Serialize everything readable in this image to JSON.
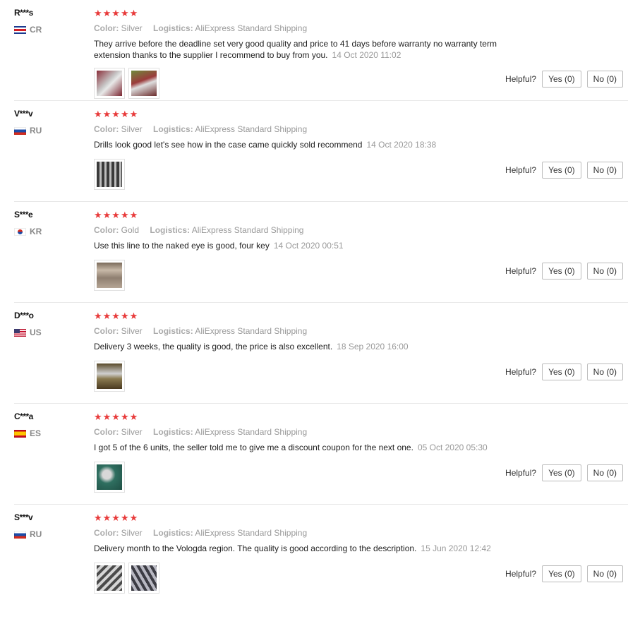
{
  "labels": {
    "color": "Color:",
    "logistics": "Logistics:",
    "helpful": "Helpful?",
    "stars": "★★★★★"
  },
  "colors": {
    "star": "#e83a3a"
  },
  "reviews": [
    {
      "user": "R***s",
      "country": "CR",
      "rating": 5,
      "color": "Silver",
      "logistics": "AliExpress Standard Shipping",
      "text": "They arrive before the deadline set very good quality and price to 41 days before warranty no warranty term extension thanks to the supplier I recommend to buy from you.",
      "date": "14 Oct 2020 11:02",
      "yes": "Yes (0)",
      "no": "No (0)"
    },
    {
      "user": "V***v",
      "country": "RU",
      "rating": 5,
      "color": "Silver",
      "logistics": "AliExpress Standard Shipping",
      "text": "Drills look good let's see how in the case came quickly sold recommend",
      "date": "14 Oct 2020 18:38",
      "yes": "Yes (0)",
      "no": "No (0)"
    },
    {
      "user": "S***e",
      "country": "KR",
      "rating": 5,
      "color": "Gold",
      "logistics": "AliExpress Standard Shipping",
      "text": "Use this line to the naked eye is good, four key",
      "date": "14 Oct 2020 00:51",
      "yes": "Yes (0)",
      "no": "No (0)"
    },
    {
      "user": "D***o",
      "country": "US",
      "rating": 5,
      "color": "Silver",
      "logistics": "AliExpress Standard Shipping",
      "text": "Delivery 3 weeks, the quality is good, the price is also excellent.",
      "date": "18 Sep 2020 16:00",
      "yes": "Yes (0)",
      "no": "No (0)"
    },
    {
      "user": "C***a",
      "country": "ES",
      "rating": 5,
      "color": "Silver",
      "logistics": "AliExpress Standard Shipping",
      "text": "I got 5 of the 6 units, the seller told me to give me a discount coupon for the next one.",
      "date": "05 Oct 2020 05:30",
      "yes": "Yes (0)",
      "no": "No (0)"
    },
    {
      "user": "S***v",
      "country": "RU",
      "rating": 5,
      "color": "Silver",
      "logistics": "AliExpress Standard Shipping",
      "text": "Delivery month to the Vologda region. The quality is good according to the description.",
      "date": "15 Jun 2020 12:42",
      "yes": "Yes (0)",
      "no": "No (0)"
    }
  ]
}
